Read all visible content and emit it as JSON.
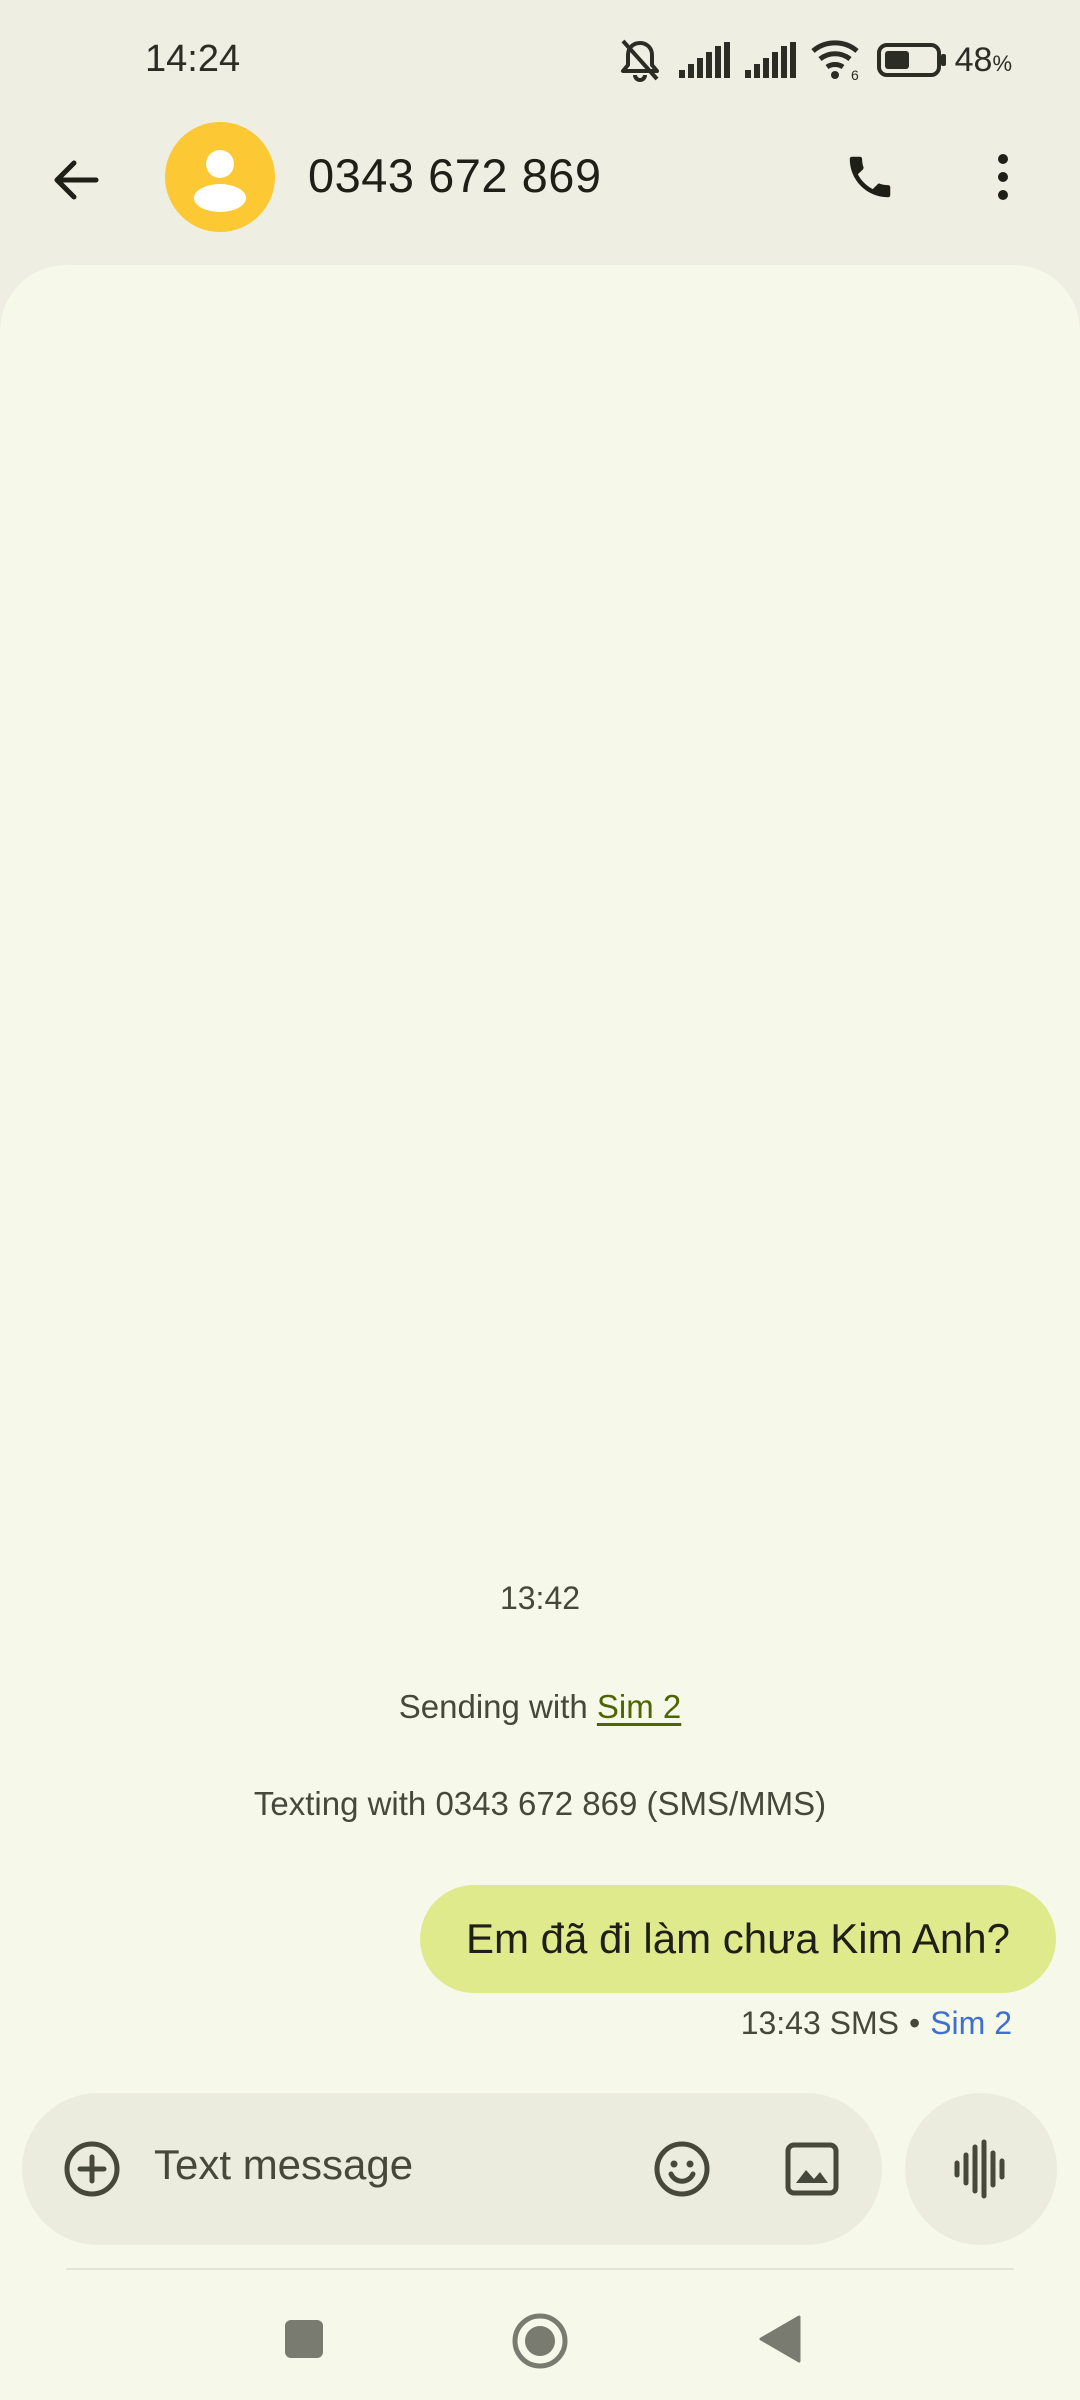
{
  "status_bar": {
    "time": "14:24",
    "battery_percent": "48",
    "battery_unit": "%",
    "icons": [
      "mute-icon",
      "signal-sim1-icon",
      "signal-sim2-icon",
      "wifi-6-icon",
      "battery-icon"
    ]
  },
  "header": {
    "contact_number": "0343 672 869",
    "avatar_color": "#fcc934",
    "icons": [
      "back-arrow-icon",
      "person-icon",
      "phone-icon",
      "more-vert-icon"
    ]
  },
  "conversation": {
    "time_divider": "13:42",
    "sending_with_prefix": "Sending with ",
    "sending_with_sim": "Sim 2",
    "texting_with": "Texting with 0343 672 869 (SMS/MMS)",
    "messages": [
      {
        "text": "Em đã đi làm chưa Kim Anh?",
        "time": "13:43",
        "type": "SMS",
        "separator": "•",
        "sim": "Sim 2",
        "bubble_color": "#dfea8c"
      }
    ]
  },
  "composer": {
    "placeholder": "Text message",
    "icons": [
      "add-circle-icon",
      "emoji-icon",
      "gallery-icon",
      "voice-icon"
    ]
  },
  "nav_bar": {
    "icons": [
      "recents-square-icon",
      "home-circle-icon",
      "back-triangle-icon"
    ]
  },
  "colors": {
    "background": "#eeeee2",
    "surface": "#f6f8ea",
    "accent_link": "#4e6500",
    "sim_blue": "#3e6fd1"
  }
}
